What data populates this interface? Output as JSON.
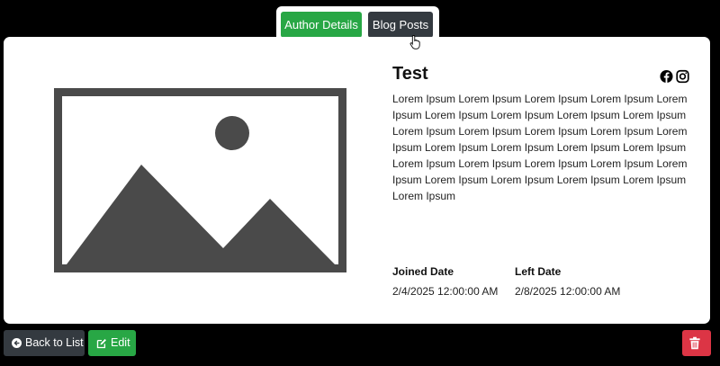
{
  "tabs": [
    {
      "label": "Author Details",
      "color": "#28a745",
      "active": true
    },
    {
      "label": "Blog Posts",
      "color": "#343a40",
      "active": false
    }
  ],
  "author": {
    "name": "Test",
    "description": "Lorem Ipsum Lorem Ipsum Lorem Ipsum Lorem Ipsum Lorem Ipsum Lorem Ipsum Lorem Ipsum Lorem Ipsum Lorem Ipsum Lorem Ipsum Lorem Ipsum Lorem Ipsum Lorem Ipsum Lorem Ipsum Lorem Ipsum Lorem Ipsum Lorem Ipsum Lorem Ipsum Lorem Ipsum Lorem Ipsum Lorem Ipsum Lorem Ipsum Lorem Ipsum Lorem Ipsum Lorem Ipsum Lorem Ipsum Lorem Ipsum Lorem Ipsum",
    "joined_label": "Joined Date",
    "joined_value": "2/4/2025 12:00:00 AM",
    "left_label": "Left Date",
    "left_value": "2/8/2025 12:00:00 AM",
    "social_icons": [
      "facebook-icon",
      "instagram-icon"
    ]
  },
  "buttons": {
    "back_label": "Back to List",
    "edit_label": "Edit"
  },
  "colors": {
    "success": "#28a745",
    "dark": "#343a40",
    "danger": "#dc3545",
    "placeholder": "#4a4a4a"
  }
}
